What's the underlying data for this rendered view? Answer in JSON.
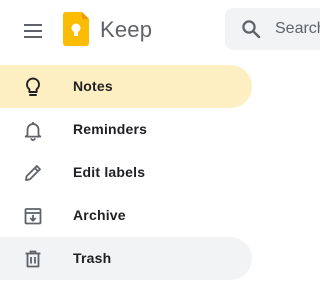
{
  "header": {
    "menu_icon": "hamburger-menu-icon",
    "logo_icon": "keep-logo",
    "title": "Keep",
    "search": {
      "placeholder": "Search",
      "icon": "search-icon"
    }
  },
  "colors": {
    "active_bg": "#feefc3",
    "hover_bg": "#f1f3f4",
    "logo_yellow": "#fbbc04",
    "icon_gray": "#5f6368"
  },
  "nav": {
    "items": [
      {
        "label": "Notes",
        "icon": "lightbulb-icon",
        "state": "active"
      },
      {
        "label": "Reminders",
        "icon": "bell-icon",
        "state": "default"
      },
      {
        "label": "Edit labels",
        "icon": "pencil-icon",
        "state": "default"
      },
      {
        "label": "Archive",
        "icon": "archive-icon",
        "state": "default"
      },
      {
        "label": "Trash",
        "icon": "trash-icon",
        "state": "hover"
      }
    ]
  }
}
